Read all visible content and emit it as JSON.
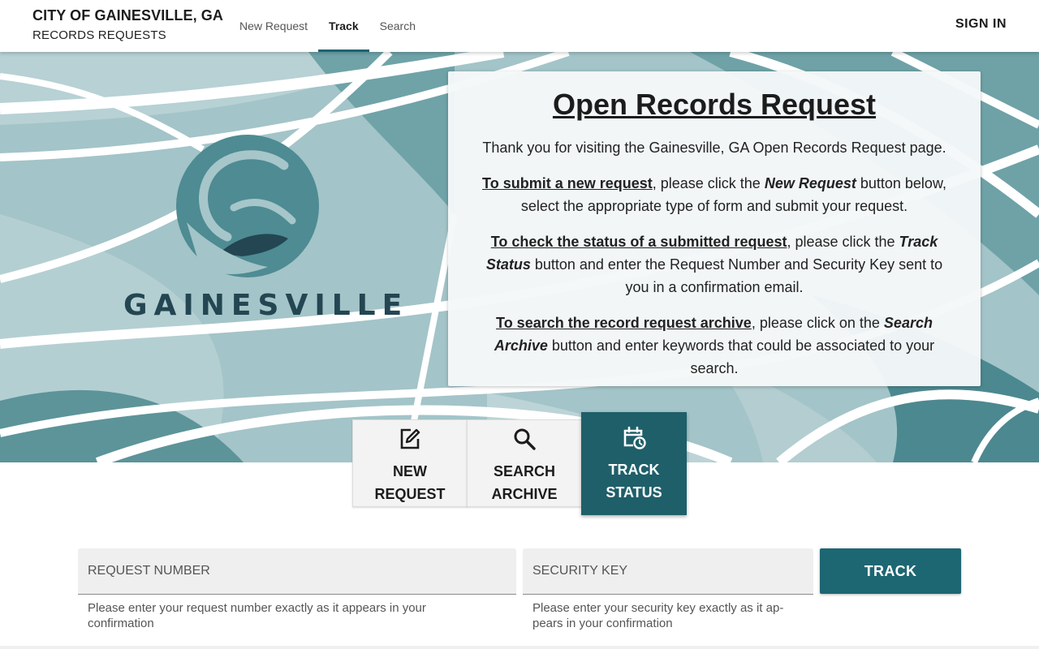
{
  "header": {
    "title": "CITY OF GAINESVILLE, GA",
    "subtitle": "RECORDS REQUESTS",
    "nav": [
      {
        "label": "New Request"
      },
      {
        "label": "Track"
      },
      {
        "label": "Search"
      }
    ],
    "sign_in": "SIGN IN"
  },
  "hero": {
    "logo_text": "GAINESVILLE",
    "card": {
      "title": "Open Records Request",
      "intro": "Thank you for visiting the Gainesville, GA Open Records Request page.",
      "p1_link": "To submit a new request",
      "p1_a": ", please click the ",
      "p1_em": "New Request",
      "p1_b": " button below, select the appropriate type of form and submit your request.",
      "p2_link": "To check the status of a submitted request",
      "p2_a": ", please click the ",
      "p2_em": "Track Status",
      "p2_b": " button and enter the Request Number and Security Key sent to you in a confirmation email.",
      "p3_link": "To search the record request archive",
      "p3_a": ", please click on the ",
      "p3_em": "Search Archive",
      "p3_b": " button and enter keywords that could be associated to your search."
    }
  },
  "actions": [
    {
      "label": "NEW REQUEST",
      "icon": "edit-icon"
    },
    {
      "label": "SEARCH ARCHIVE",
      "icon": "search-icon"
    },
    {
      "label": "TRACK STATUS",
      "icon": "calendar-clock-icon"
    }
  ],
  "form": {
    "request_number_placeholder": "REQUEST NUMBER",
    "request_number_value": "",
    "request_number_hint": "Please enter your request number exactly as it appears in your confirmation",
    "security_key_placeholder": "SECURITY KEY",
    "security_key_value": "",
    "security_key_hint": "Please enter your security key exactly as it ap­pears in your confirmation",
    "track_button": "TRACK"
  },
  "colors": {
    "accent": "#1c6772",
    "active_tile": "#1e5f69",
    "logo_dark": "#234652",
    "logo_teal": "#4e8b93"
  }
}
